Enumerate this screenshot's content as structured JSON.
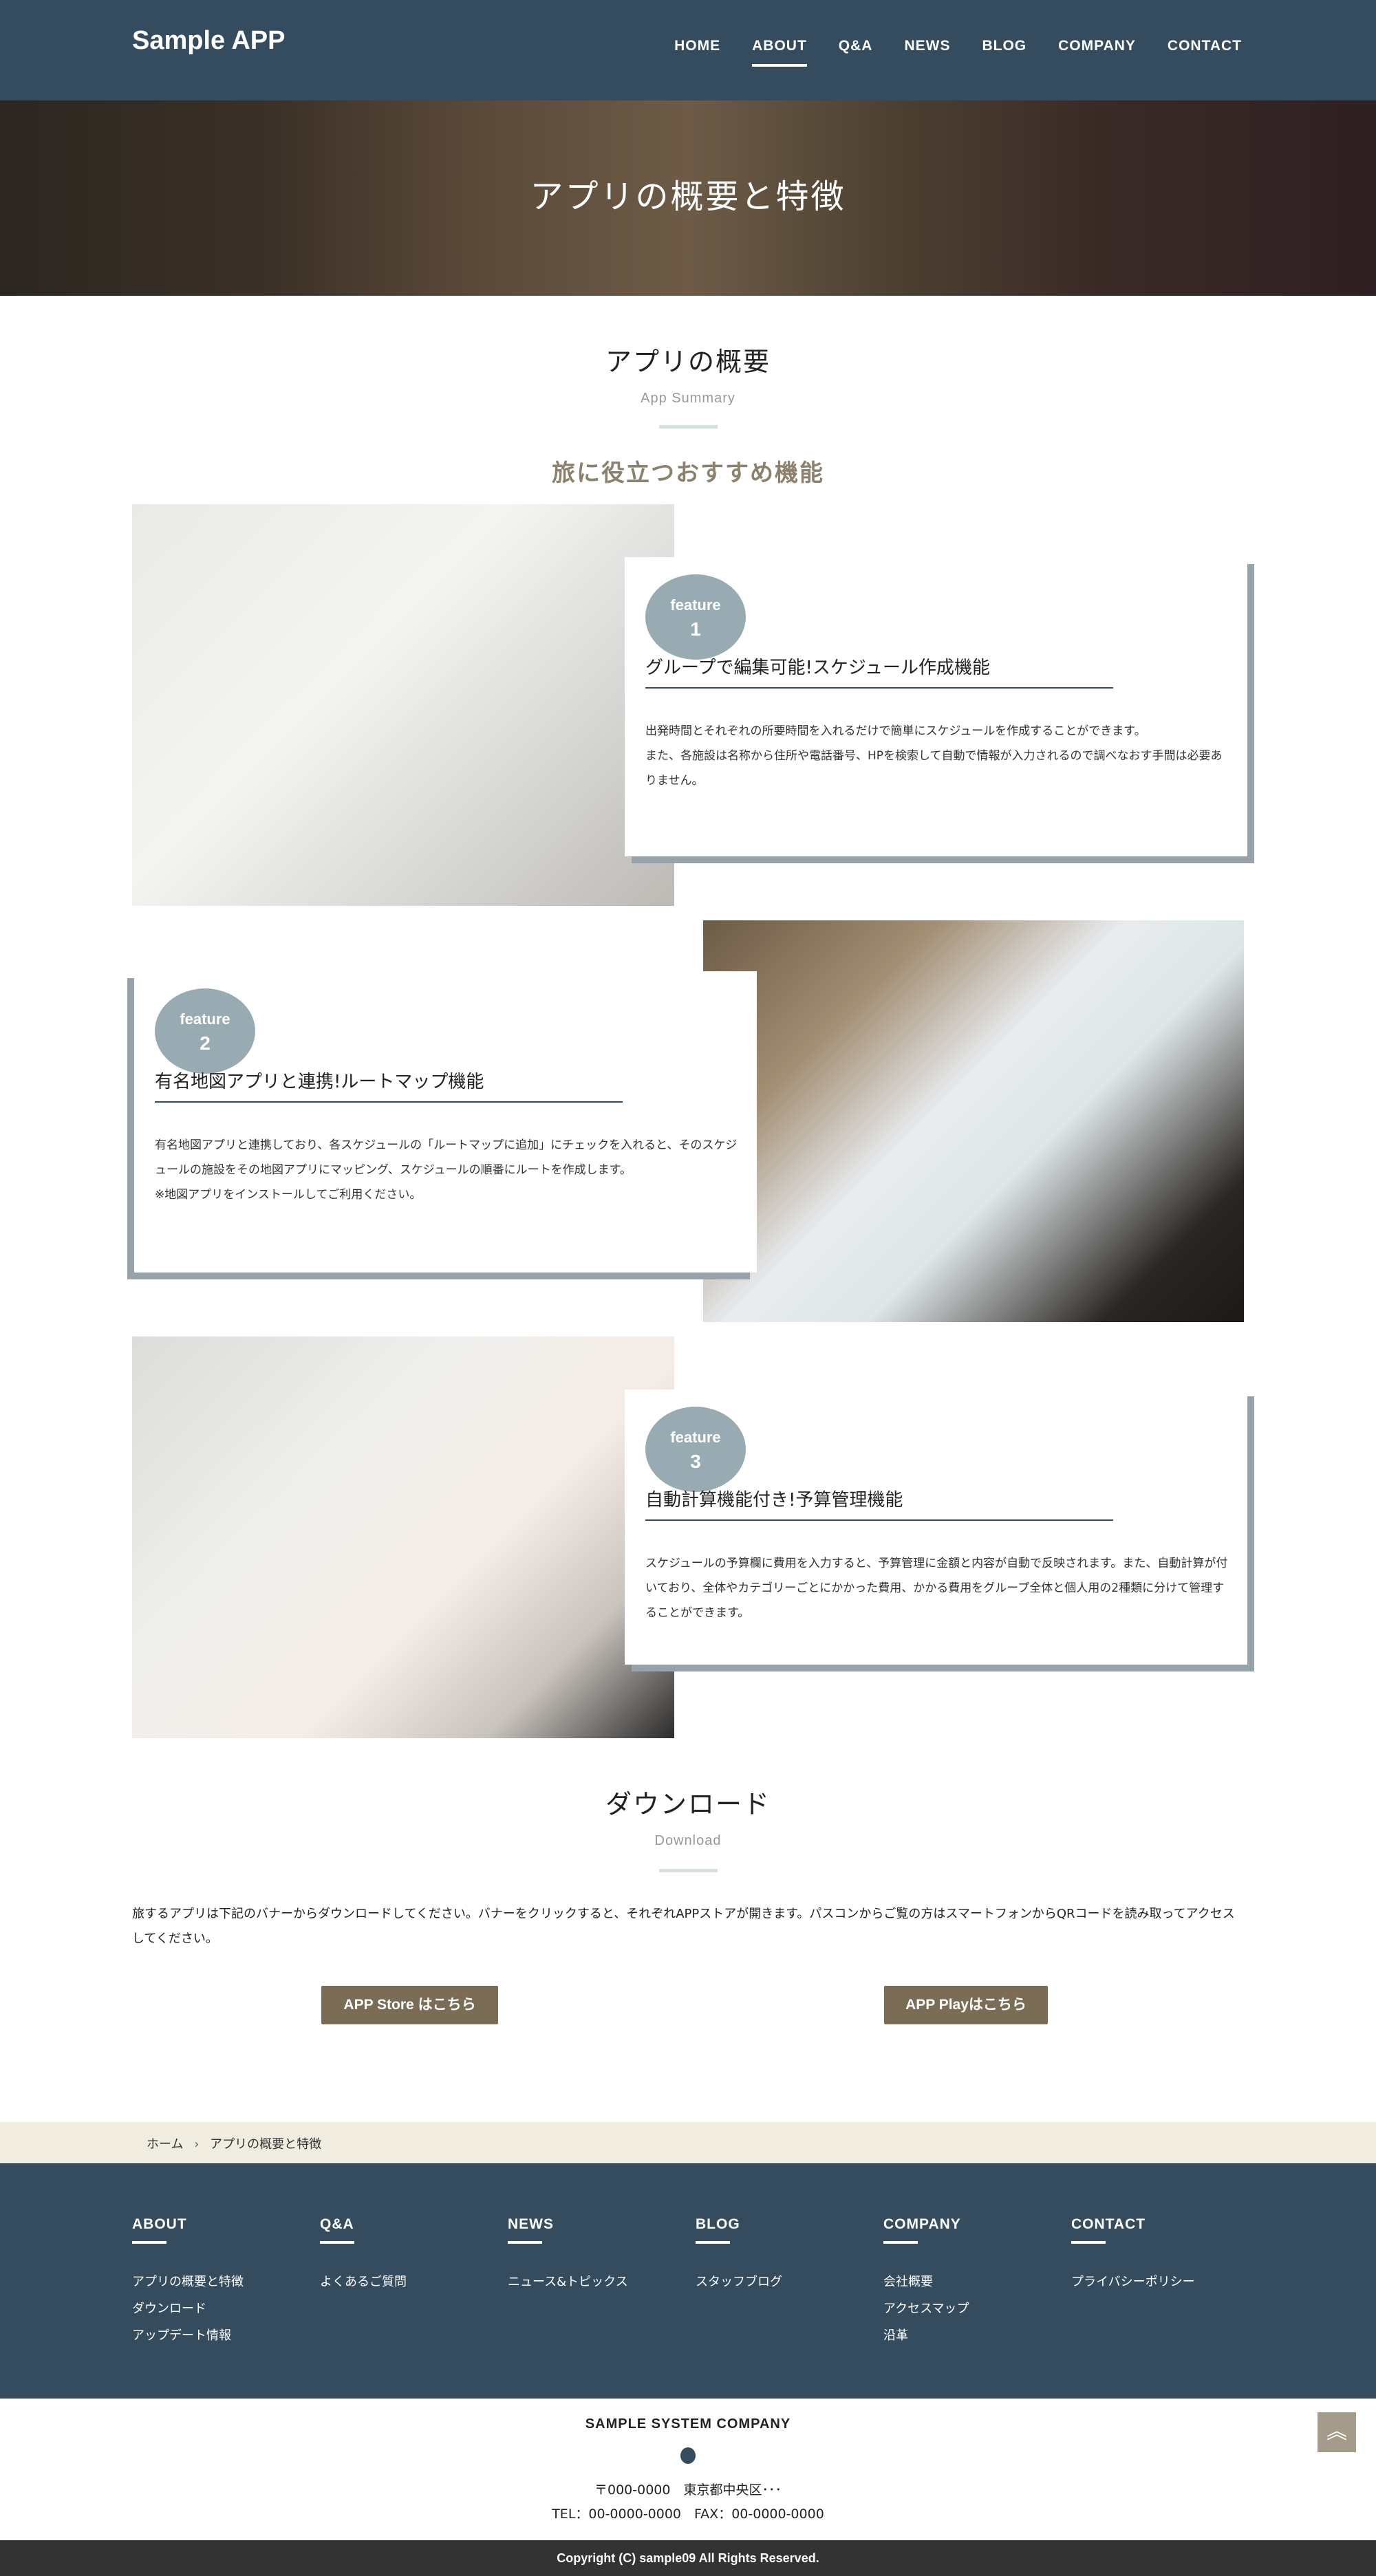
{
  "header": {
    "logo": "Sample APP",
    "nav": [
      "HOME",
      "ABOUT",
      "Q&A",
      "NEWS",
      "BLOG",
      "COMPANY",
      "CONTACT"
    ],
    "active": "ABOUT"
  },
  "hero": {
    "title": "アプリの概要と特徴"
  },
  "summary": {
    "title": "アプリの概要",
    "subtitle": "App Summary",
    "heading": "旅に役立つおすすめ機能",
    "features": [
      {
        "badge": "feature",
        "number": "1",
        "title": "グループで編集可能!スケジュール作成機能",
        "text": "出発時間とそれぞれの所要時間を入れるだけで簡単にスケジュールを作成することができます。\nまた、各施設は名称から住所や電話番号、HPを検索して自動で情報が入力されるので調べなおす手間は必要ありません。"
      },
      {
        "badge": "feature",
        "number": "2",
        "title": "有名地図アプリと連携!ルートマップ機能",
        "text": "有名地図アプリと連携しており、各スケジュールの「ルートマップに追加」にチェックを入れると、そのスケジュールの施設をその地図アプリにマッピング、スケジュールの順番にルートを作成します。\n※地図アプリをインストールしてご利用ください。"
      },
      {
        "badge": "feature",
        "number": "3",
        "title": "自動計算機能付き!予算管理機能",
        "text": "スケジュールの予算欄に費用を入力すると、予算管理に金額と内容が自動で反映されます。また、自動計算が付いており、全体やカテゴリーごとにかかった費用、かかる費用をグループ全体と個人用の2種類に分けて管理することができます。"
      }
    ]
  },
  "download": {
    "title": "ダウンロード",
    "subtitle": "Download",
    "text": "旅するアプリは下記のバナーからダウンロードしてください。バナーをクリックすると、それぞれAPPストアが開きます。パスコンからご覧の方はスマートフォンからQRコードを読み取ってアクセスしてください。",
    "app_store": "APP Store はこちら",
    "app_play": "APP Playはこちら"
  },
  "breadcrumb": {
    "home": "ホーム",
    "separator": "›",
    "current": "アプリの概要と特徴"
  },
  "footer": {
    "columns": [
      {
        "title": "ABOUT",
        "links": [
          "アプリの概要と特徴",
          "ダウンロード",
          "アップデート情報"
        ]
      },
      {
        "title": "Q&A",
        "links": [
          "よくあるご質問"
        ]
      },
      {
        "title": "NEWS",
        "links": [
          "ニュース&トピックス"
        ]
      },
      {
        "title": "BLOG",
        "links": [
          "スタッフブログ"
        ]
      },
      {
        "title": "COMPANY",
        "links": [
          "会社概要",
          "アクセスマップ",
          "沿革"
        ]
      },
      {
        "title": "CONTACT",
        "links": [
          "プライバシーポリシー"
        ]
      }
    ],
    "company": "SAMPLE SYSTEM COMPANY",
    "address": "〒000-0000　東京都中央区･･･",
    "tel": "TEL：00-0000-0000　FAX：00-0000-0000",
    "copyright": "Copyright (C) sample09 All Rights Reserved."
  },
  "colors": {
    "navy": "#354b5e",
    "badge": "#98abb3",
    "button": "#7a6c55",
    "accent_text": "#8b816c",
    "breadcrumb_bg": "#f1ece0"
  },
  "icons": {
    "back_to_top": "double-chevron-up-icon"
  }
}
